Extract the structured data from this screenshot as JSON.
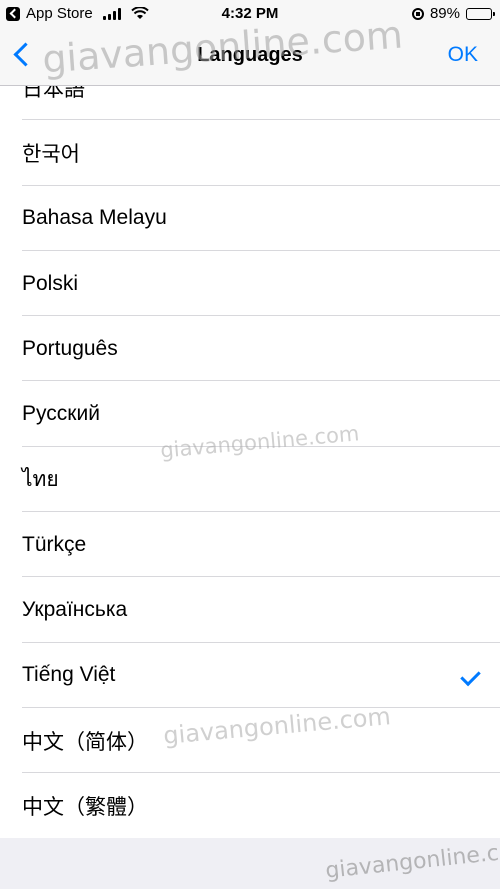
{
  "status_bar": {
    "back_app_label": "App Store",
    "time": "4:32 PM",
    "battery_percent": "89%",
    "battery_level": 0.89
  },
  "nav": {
    "title": "Languages",
    "done_label": "OK"
  },
  "languages": [
    {
      "label": "日本語",
      "selected": false
    },
    {
      "label": "한국어",
      "selected": false
    },
    {
      "label": "Bahasa Melayu",
      "selected": false
    },
    {
      "label": "Polski",
      "selected": false
    },
    {
      "label": "Português",
      "selected": false
    },
    {
      "label": "Русский",
      "selected": false
    },
    {
      "label": "ไทย",
      "selected": false
    },
    {
      "label": "Türkçe",
      "selected": false
    },
    {
      "label": "Українська",
      "selected": false
    },
    {
      "label": "Tiếng Việt",
      "selected": true
    },
    {
      "label": "中文（简体）",
      "selected": false
    },
    {
      "label": "中文（繁體）",
      "selected": false
    }
  ],
  "watermarks": [
    "giavangonline.com",
    "giavangonline.com",
    "giavangonline.com",
    "giavangonline.com"
  ],
  "colors": {
    "accent": "#007aff",
    "background": "#efeff4"
  }
}
